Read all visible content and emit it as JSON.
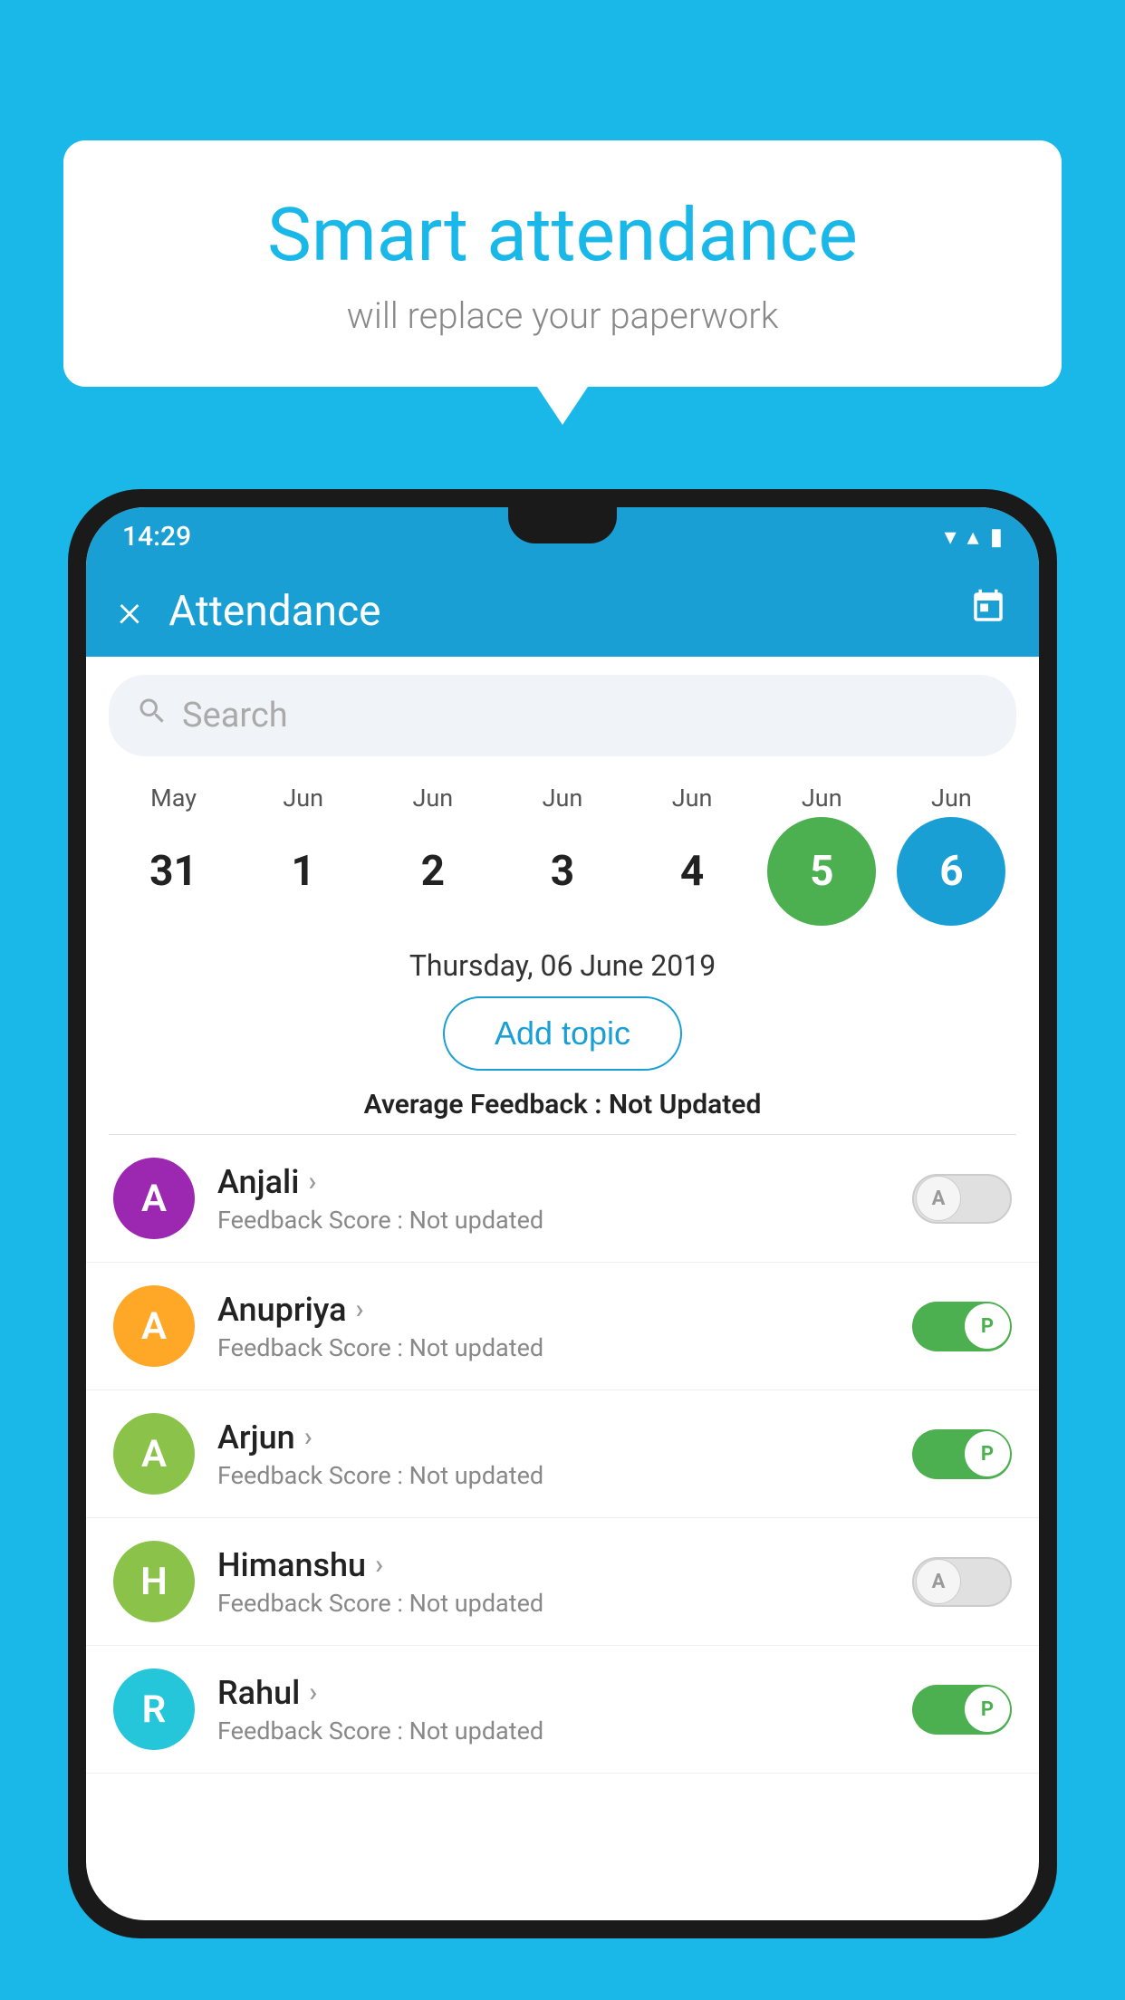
{
  "background_color": "#1ab8e8",
  "speech_bubble": {
    "title": "Smart attendance",
    "subtitle": "will replace your paperwork"
  },
  "status_bar": {
    "time": "14:29",
    "wifi_icon": "▼",
    "signal_icon": "▲",
    "battery_icon": "▮"
  },
  "app_bar": {
    "title": "Attendance",
    "close_label": "×",
    "calendar_label": "📅"
  },
  "search": {
    "placeholder": "Search"
  },
  "calendar": {
    "months": [
      "May",
      "Jun",
      "Jun",
      "Jun",
      "Jun",
      "Jun",
      "Jun"
    ],
    "dates": [
      "31",
      "1",
      "2",
      "3",
      "4",
      "5",
      "6"
    ],
    "today_index": 5,
    "selected_index": 6,
    "selected_date_label": "Thursday, 06 June 2019"
  },
  "add_topic_button": "Add topic",
  "average_feedback": {
    "label": "Average Feedback :",
    "value": "Not Updated"
  },
  "students": [
    {
      "name": "Anjali",
      "avatar_letter": "A",
      "avatar_color": "#9c27b0",
      "feedback": "Feedback Score : Not updated",
      "attendance": "absent"
    },
    {
      "name": "Anupriya",
      "avatar_letter": "A",
      "avatar_color": "#ffa726",
      "feedback": "Feedback Score : Not updated",
      "attendance": "present"
    },
    {
      "name": "Arjun",
      "avatar_letter": "A",
      "avatar_color": "#8bc34a",
      "feedback": "Feedback Score : Not updated",
      "attendance": "present"
    },
    {
      "name": "Himanshu",
      "avatar_letter": "H",
      "avatar_color": "#8bc34a",
      "feedback": "Feedback Score : Not updated",
      "attendance": "absent"
    },
    {
      "name": "Rahul",
      "avatar_letter": "R",
      "avatar_color": "#26c6da",
      "feedback": "Feedback Score : Not updated",
      "attendance": "present"
    }
  ]
}
